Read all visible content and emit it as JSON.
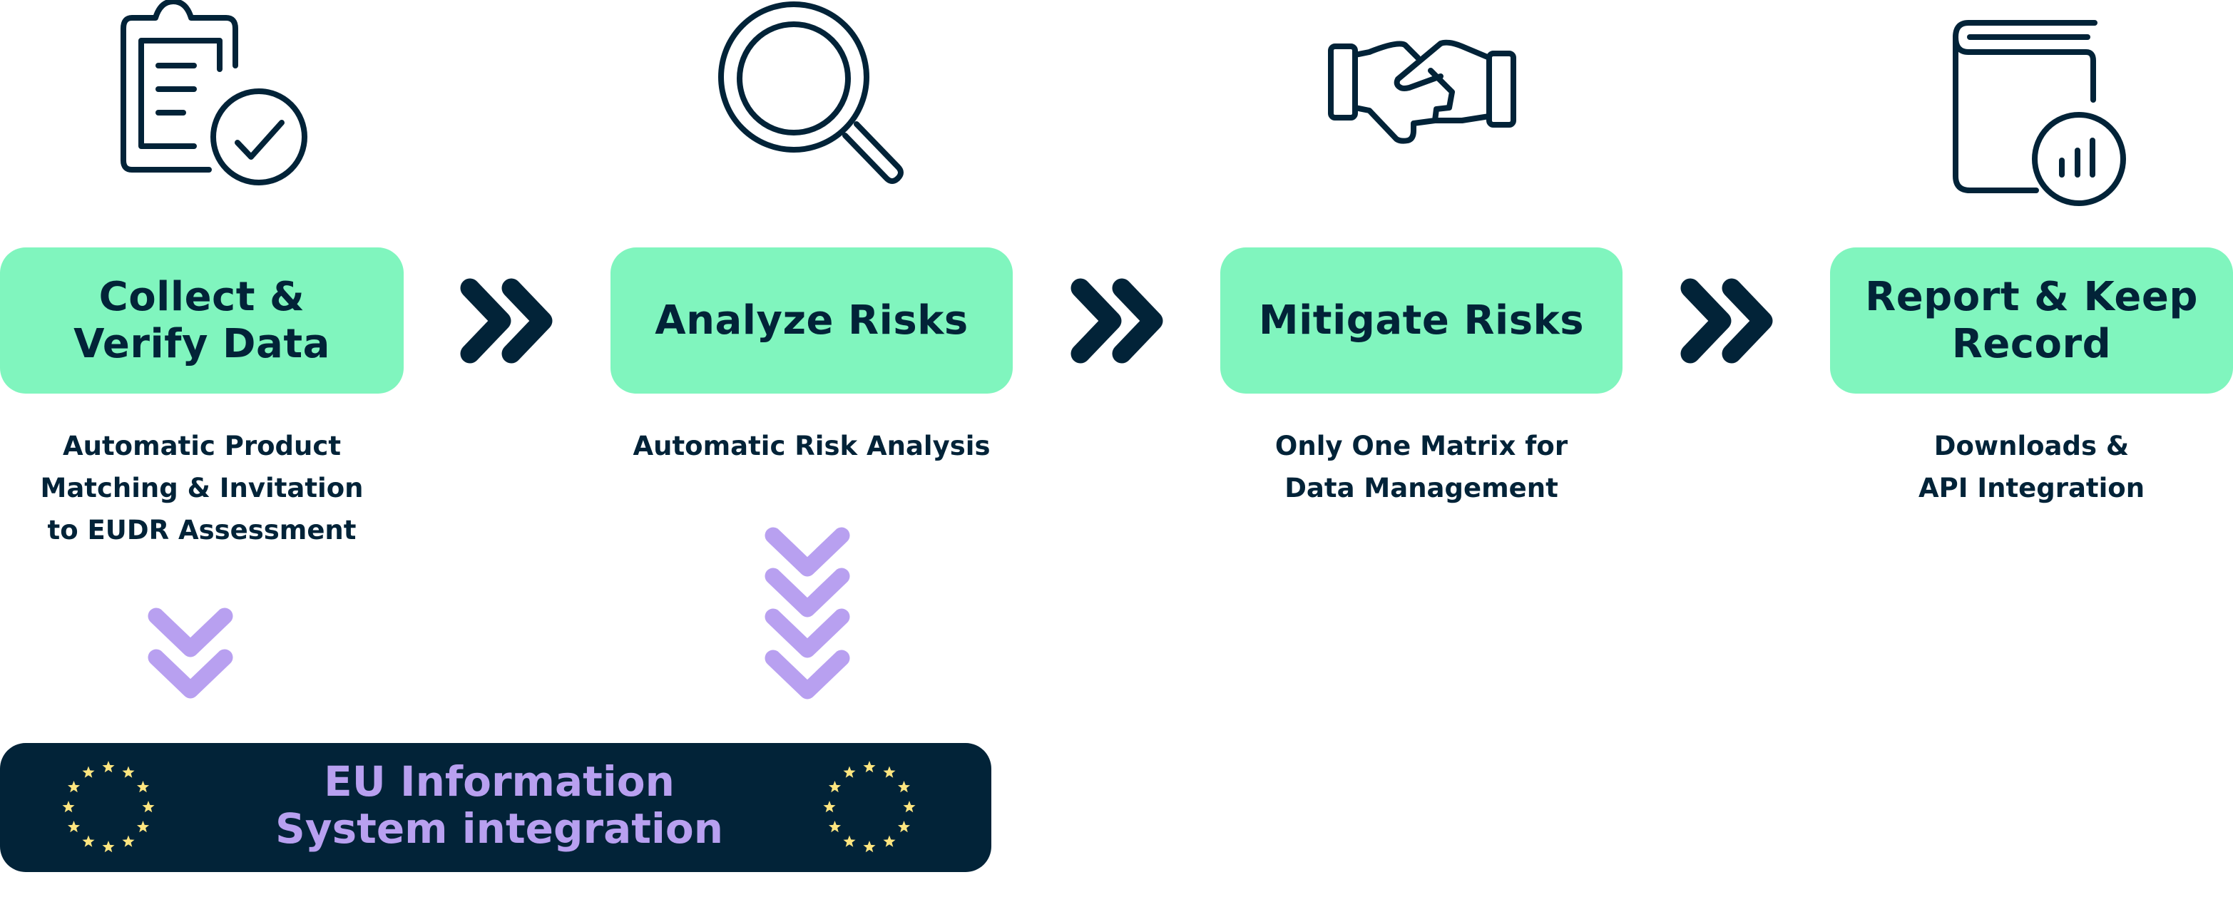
{
  "colors": {
    "box_fill": "#80F5BE",
    "navy": "#022338",
    "purple": "#B8A0F0",
    "star_yellow": "#FFE680",
    "background": "#FFFFFF"
  },
  "steps": [
    {
      "icon": "clipboard-check-icon",
      "title": "Collect &\nVerify Data",
      "description": "Automatic Product\nMatching & Invitation\nto EUDR Assessment"
    },
    {
      "icon": "magnifying-glass-icon",
      "title": "Analyze Risks",
      "description": "Automatic Risk Analysis"
    },
    {
      "icon": "handshake-icon",
      "title": "Mitigate Risks",
      "description": "Only One Matrix for\nData Management"
    },
    {
      "icon": "book-chart-icon",
      "title": "Report & Keep\nRecord",
      "description": "Downloads &\nAPI Integration"
    }
  ],
  "connectors": {
    "between_steps": "double-chevron-right-icon",
    "to_eu_from_step1": "double-chevron-down-icon",
    "to_eu_from_step2": "quadruple-chevron-down-icon"
  },
  "eu_integration": {
    "title": "EU Information\nSystem integration",
    "flag_icon": "eu-stars-icon"
  }
}
